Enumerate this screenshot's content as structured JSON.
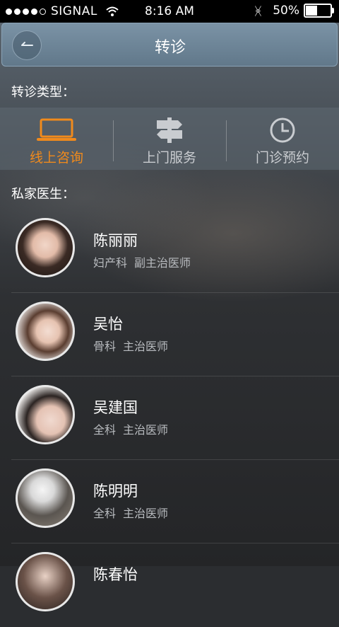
{
  "status_bar": {
    "carrier": "SIGNAL",
    "time": "8:16 AM",
    "battery_text": "50%",
    "battery_level": 0.5
  },
  "nav": {
    "title": "转诊",
    "back_icon": "back-arrow-icon"
  },
  "referral_types": {
    "label": "转诊类型：",
    "items": [
      {
        "label": "线上咨询",
        "icon": "laptop-icon",
        "active": true
      },
      {
        "label": "上门服务",
        "icon": "signpost-icon",
        "active": false
      },
      {
        "label": "门诊预约",
        "icon": "clock-icon",
        "active": false
      }
    ],
    "active_color": "#f08a1c"
  },
  "private_doctors": {
    "label": "私家医生：",
    "doctors": [
      {
        "name": "陈丽丽",
        "dept": "妇产科",
        "title": "副主治医师"
      },
      {
        "name": "吴怡",
        "dept": "骨科",
        "title": "主治医师"
      },
      {
        "name": "吴建国",
        "dept": "全科",
        "title": "主治医师"
      },
      {
        "name": "陈明明",
        "dept": "全科",
        "title": "主治医师"
      },
      {
        "name": "陈春怡",
        "dept": "",
        "title": ""
      }
    ]
  }
}
